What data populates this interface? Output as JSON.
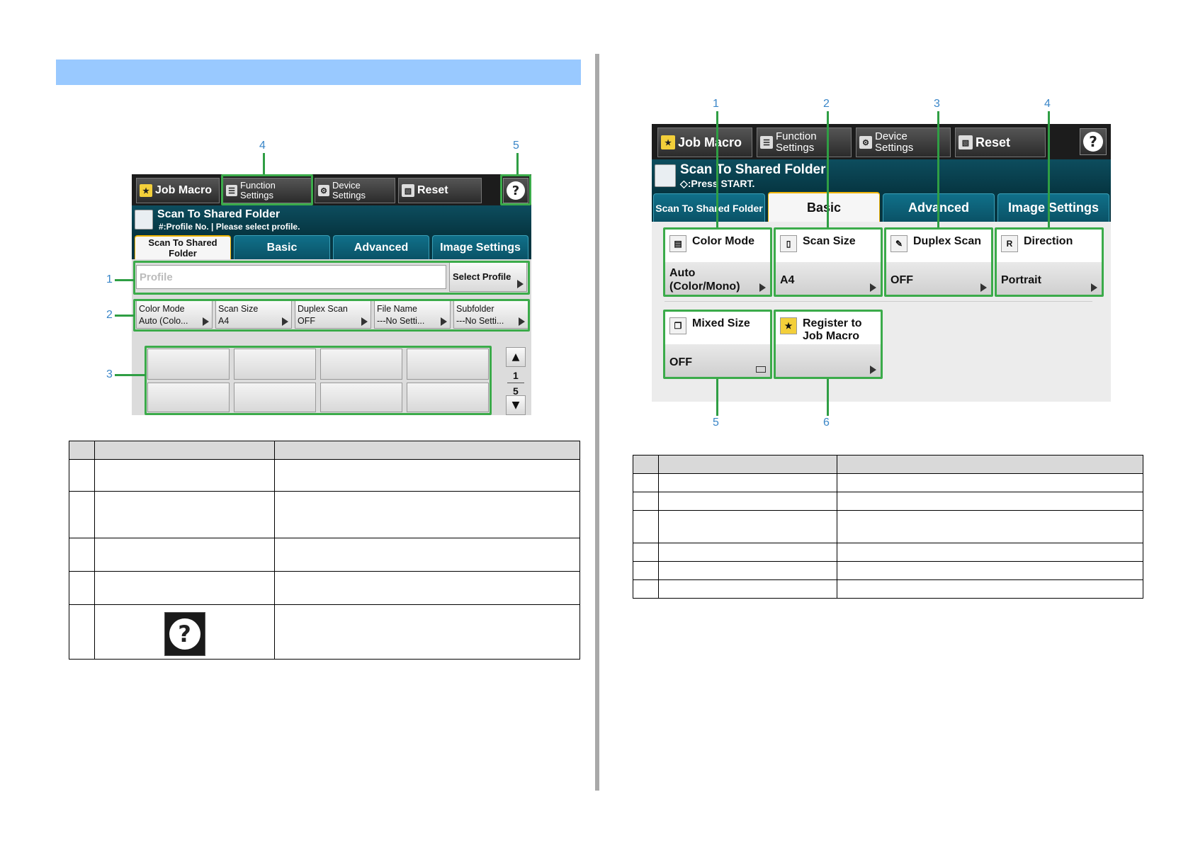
{
  "left_panel": {
    "toolbar": {
      "job_macro": "Job Macro",
      "function_settings": [
        "Function",
        "Settings"
      ],
      "device_settings": [
        "Device",
        "Settings"
      ],
      "reset": "Reset",
      "help": "?"
    },
    "title": "Scan To Shared Folder",
    "subtitle": "#:Profile No. | Please select profile.",
    "tabs": [
      {
        "label": "Scan To Shared Folder",
        "active": true
      },
      {
        "label": "Basic",
        "active": false
      },
      {
        "label": "Advanced",
        "active": false
      },
      {
        "label": "Image Settings",
        "active": false
      }
    ],
    "profile_placeholder": "Profile",
    "select_profile": "Select Profile",
    "functions": [
      {
        "label": "Color Mode",
        "value": "Auto (Colo..."
      },
      {
        "label": "Scan Size",
        "value": "A4"
      },
      {
        "label": "Duplex Scan",
        "value": "OFF"
      },
      {
        "label": "File Name",
        "value": "---No Setti..."
      },
      {
        "label": "Subfolder",
        "value": "---No Setti..."
      }
    ],
    "pager": {
      "current": "1",
      "total": "5",
      "up": "▲",
      "down": "▼"
    },
    "callouts": [
      "1",
      "2",
      "3",
      "4",
      "5"
    ]
  },
  "right_panel": {
    "toolbar": {
      "job_macro": "Job Macro",
      "function_settings": [
        "Function",
        "Settings"
      ],
      "device_settings": [
        "Device",
        "Settings"
      ],
      "reset": "Reset",
      "help": "?"
    },
    "title": "Scan To Shared Folder",
    "subtitle": "◇:Press START.",
    "tabs": [
      {
        "label": "Scan To Shared Folder",
        "active": false
      },
      {
        "label": "Basic",
        "active": true
      },
      {
        "label": "Advanced",
        "active": false
      },
      {
        "label": "Image Settings",
        "active": false
      }
    ],
    "tiles": [
      {
        "label": "Color Mode",
        "value": "Auto (Color/Mono)",
        "icon": "color-mode-icon"
      },
      {
        "label": "Scan Size",
        "value": "A4",
        "icon": "scan-size-icon"
      },
      {
        "label": "Duplex Scan",
        "value": "OFF",
        "icon": "duplex-scan-icon"
      },
      {
        "label": "Direction",
        "value": "Portrait",
        "icon": "direction-icon"
      },
      {
        "label": "Mixed Size",
        "value": "OFF",
        "icon": "mixed-size-icon"
      },
      {
        "label": "Register to Job Macro",
        "value": "",
        "icon": "star-add-icon"
      }
    ],
    "callouts": [
      "1",
      "2",
      "3",
      "4",
      "5",
      "6"
    ]
  },
  "left_table": {
    "rows": 5
  },
  "right_table": {
    "rows": 6
  }
}
